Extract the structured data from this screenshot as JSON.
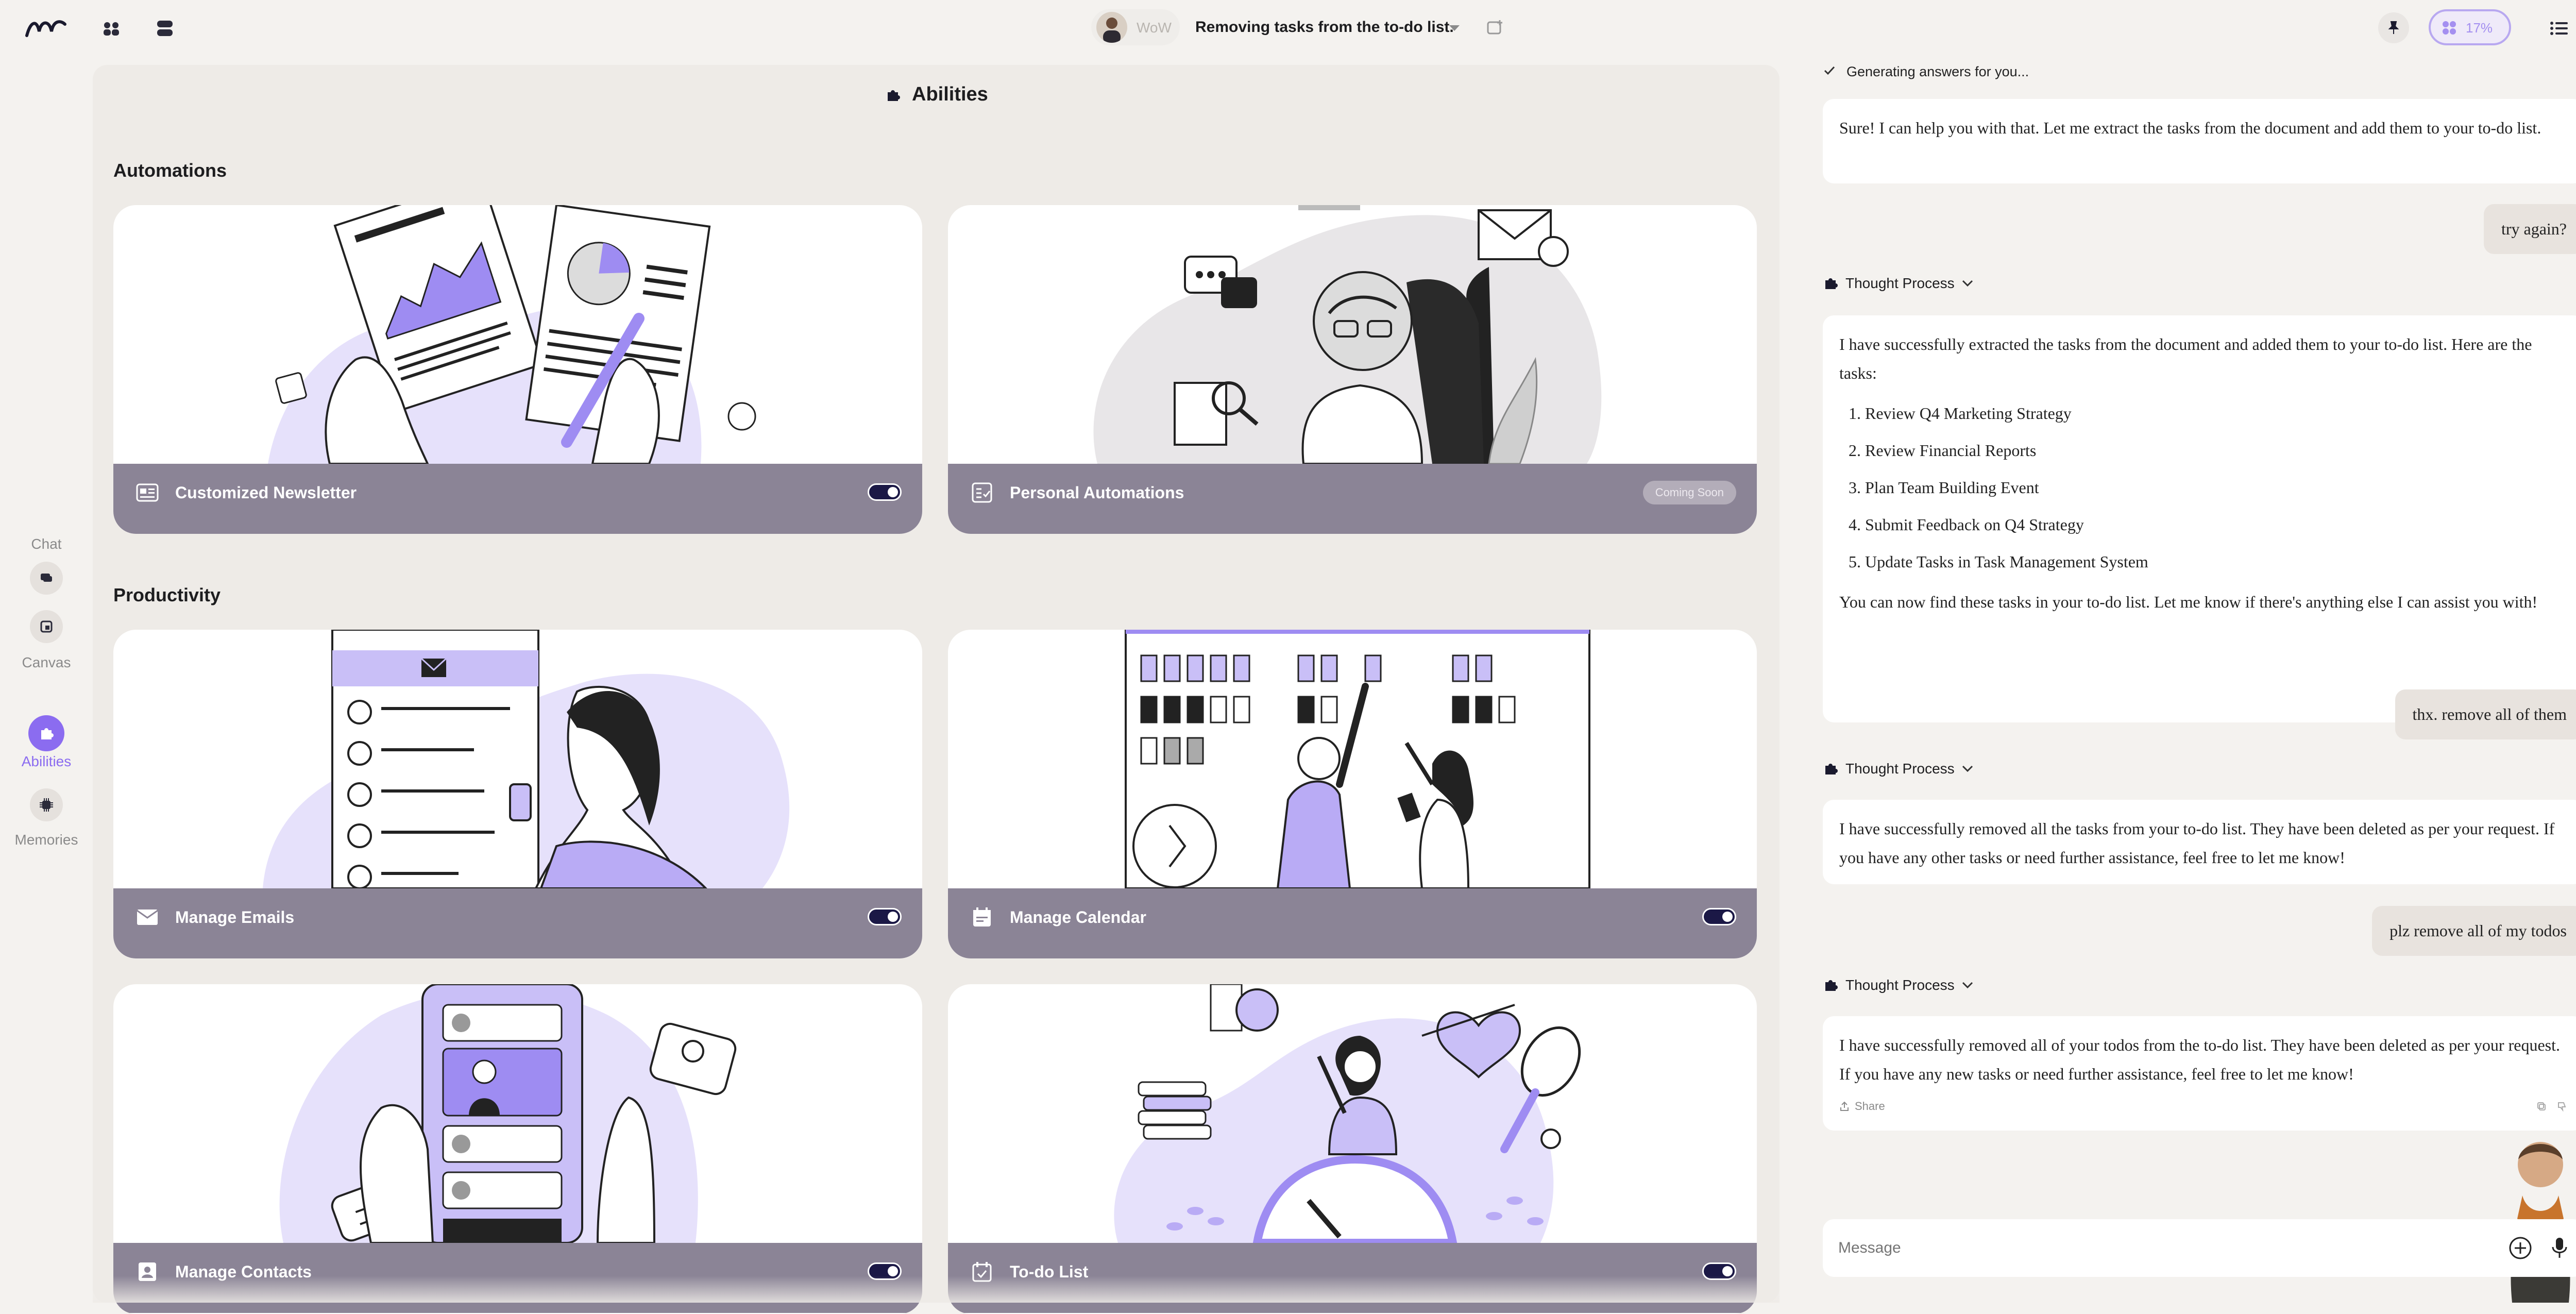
{
  "topbar": {
    "agent_name": "WoW",
    "conversation_title": "Removing tasks from the to-do list.",
    "usage_percent": "17%"
  },
  "rail": {
    "chat_label": "Chat",
    "canvas_label": "Canvas",
    "abilities_label": "Abilities",
    "memories_label": "Memories"
  },
  "main": {
    "heading": "Abilities",
    "sections": {
      "automations": "Automations",
      "productivity": "Productivity"
    },
    "cards": {
      "newsletter": {
        "title": "Customized Newsletter",
        "enabled": true
      },
      "personal": {
        "title": "Personal Automations",
        "badge": "Coming Soon"
      },
      "emails": {
        "title": "Manage Emails",
        "enabled": true
      },
      "calendar": {
        "title": "Manage Calendar",
        "enabled": true
      },
      "contacts": {
        "title": "Manage Contacts",
        "enabled": true
      },
      "todo": {
        "title": "To-do List",
        "enabled": true
      }
    }
  },
  "chat": {
    "status": "Generating answers for you...",
    "m1": "Sure! I can help you with that. Let me extract the tasks from the document and add them to your to-do list.",
    "u1": "try again?",
    "thought_label": "Thought Process",
    "m2_intro": "I have successfully extracted the tasks from the document and added them to your to-do list. Here are the tasks:",
    "tasks": [
      "Review Q4 Marketing Strategy",
      "Review Financial Reports",
      "Plan Team Building Event",
      "Submit Feedback on Q4 Strategy",
      "Update Tasks in Task Management System"
    ],
    "m2_outro": "You can now find these tasks in your to-do list. Let me know if there's anything else I can assist you with!",
    "u2": "thx. remove all of them",
    "m3": "I have successfully removed all the tasks from your to-do list. They have been deleted as per your request. If you have any other tasks or need further assistance, feel free to let me know!",
    "u3": "plz remove all of my todos",
    "m4": "I have successfully removed all of your todos from the to-do list. They have been deleted as per your request. If you have any new tasks or need further assistance, feel free to let me know!",
    "share_label": "Share",
    "input_placeholder": "Message"
  },
  "colors": {
    "accent": "#8b6cf0",
    "card_bar": "#8b8496",
    "toggle": "#1b1846",
    "illustration": "#c9bff7"
  }
}
